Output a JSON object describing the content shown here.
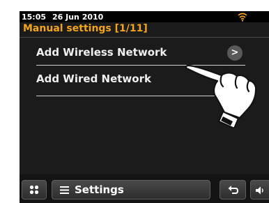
{
  "status_bar": {
    "time": "15:05",
    "date": "26 Jun 2010",
    "wifi_icon": "wifi-signal-icon"
  },
  "header": {
    "title": "Manual settings [1/11]"
  },
  "menu": {
    "items": [
      {
        "label": "Add Wireless Network",
        "arrow_label": ">"
      },
      {
        "label": "Add Wired Network"
      }
    ]
  },
  "bottom_bar": {
    "grid_icon": "grid-icon",
    "menu_icon": "hamburger-icon",
    "settings_label": "Settings",
    "back_icon": "back-arrow-icon",
    "volume_icon": "speaker-icon"
  },
  "overlay": {
    "icon": "pointer-hand-icon"
  },
  "colors": {
    "screen_background": "#1b1b1b",
    "title_accent": "#f2a51a",
    "text": "#f0f0f0",
    "button_fill": "#3c3c3c"
  }
}
